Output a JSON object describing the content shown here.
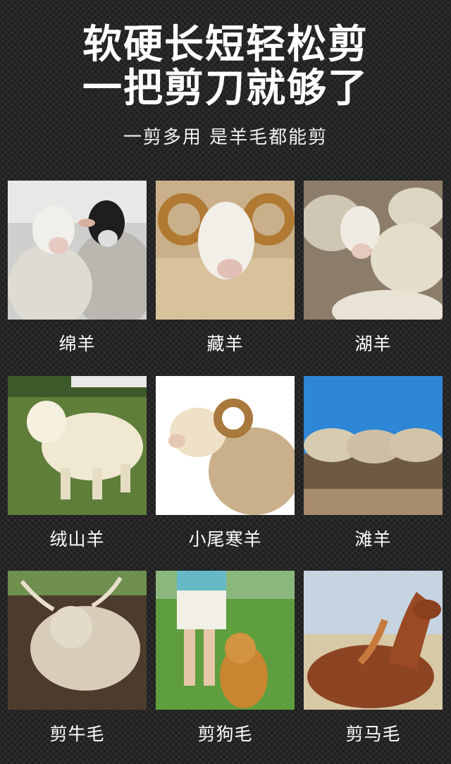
{
  "header": {
    "title_line1": "软硬长短轻松剪",
    "title_line2": "一把剪刀就够了",
    "subtitle": "一剪多用 是羊毛都能剪"
  },
  "grid": [
    {
      "label": "绵羊"
    },
    {
      "label": "藏羊"
    },
    {
      "label": "湖羊"
    },
    {
      "label": "绒山羊"
    },
    {
      "label": "小尾寒羊"
    },
    {
      "label": "滩羊"
    },
    {
      "label": "剪牛毛"
    },
    {
      "label": "剪狗毛"
    },
    {
      "label": "剪马毛"
    }
  ]
}
